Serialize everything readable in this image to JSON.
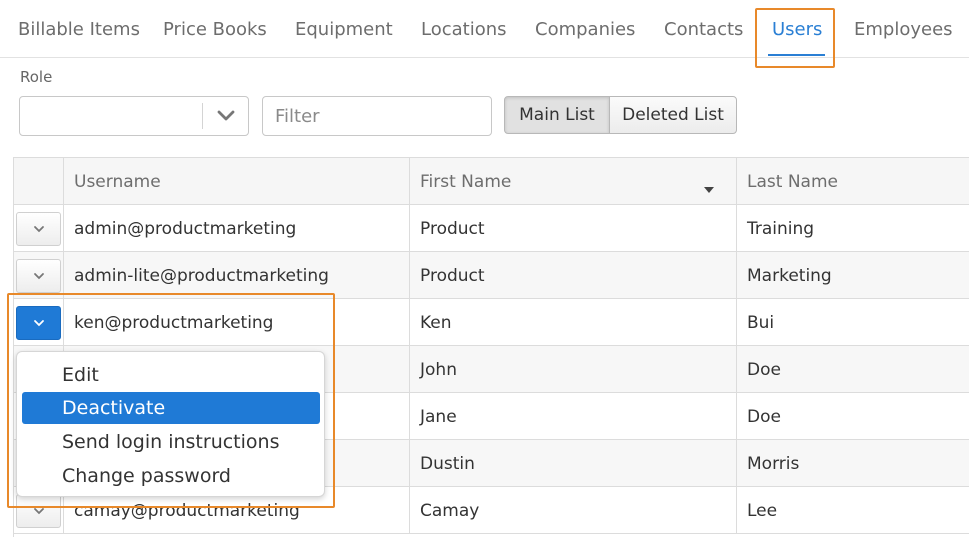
{
  "tabs": [
    {
      "label": "Billable Items",
      "active": false
    },
    {
      "label": "Price Books",
      "active": false
    },
    {
      "label": "Equipment",
      "active": false
    },
    {
      "label": "Locations",
      "active": false
    },
    {
      "label": "Companies",
      "active": false
    },
    {
      "label": "Contacts",
      "active": false
    },
    {
      "label": "Users",
      "active": true
    },
    {
      "label": "Employees",
      "active": false
    }
  ],
  "filters": {
    "role_label": "Role",
    "role_value": "",
    "filter_placeholder": "Filter",
    "filter_value": "",
    "segments": [
      {
        "label": "Main List",
        "active": true
      },
      {
        "label": "Deleted List",
        "active": false
      }
    ]
  },
  "grid": {
    "columns": [
      "Username",
      "First Name",
      "Last Name"
    ],
    "sorted_column": "First Name",
    "rows": [
      {
        "username": "admin@productmarketing",
        "first": "Product",
        "last": "Training"
      },
      {
        "username": "admin-lite@productmarketing",
        "first": "Product",
        "last": "Marketing"
      },
      {
        "username": "ken@productmarketing",
        "first": "Ken",
        "last": "Bui"
      },
      {
        "username": "",
        "first": "John",
        "last": "Doe"
      },
      {
        "username": "",
        "first": "Jane",
        "last": "Doe"
      },
      {
        "username": "",
        "first": "Dustin",
        "last": "Morris"
      },
      {
        "username": "camay@productmarketing",
        "first": "Camay",
        "last": "Lee"
      }
    ]
  },
  "context_menu": {
    "items": [
      {
        "label": "Edit",
        "selected": false
      },
      {
        "label": "Deactivate",
        "selected": true
      },
      {
        "label": "Send login instructions",
        "selected": false
      },
      {
        "label": "Change password",
        "selected": false
      }
    ]
  },
  "colors": {
    "accent": "#1f7ad6",
    "highlight_box": "#e8892a"
  }
}
